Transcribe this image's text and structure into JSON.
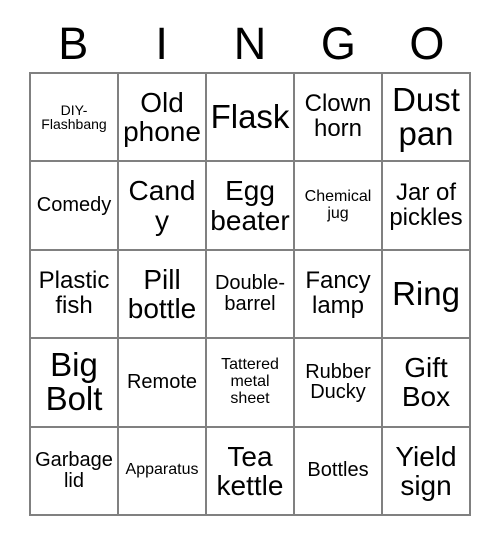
{
  "card": {
    "headers": [
      "B",
      "I",
      "N",
      "G",
      "O"
    ],
    "rows": [
      [
        {
          "text": "DIY-Flashbang",
          "size": "xxs"
        },
        {
          "text": "Old phone",
          "size": "lg"
        },
        {
          "text": "Flask",
          "size": "xl"
        },
        {
          "text": "Clown horn",
          "size": "md"
        },
        {
          "text": "Dust pan",
          "size": "xl"
        }
      ],
      [
        {
          "text": "Comedy",
          "size": "sm"
        },
        {
          "text": "Candy",
          "size": "lg"
        },
        {
          "text": "Egg beater",
          "size": "lg"
        },
        {
          "text": "Chemical jug",
          "size": "xs"
        },
        {
          "text": "Jar of pickles",
          "size": "md"
        }
      ],
      [
        {
          "text": "Plastic fish",
          "size": "md"
        },
        {
          "text": "Pill bottle",
          "size": "lg"
        },
        {
          "text": "Double-barrel",
          "size": "sm"
        },
        {
          "text": "Fancy lamp",
          "size": "md"
        },
        {
          "text": "Ring",
          "size": "xl"
        }
      ],
      [
        {
          "text": "Big Bolt",
          "size": "xl"
        },
        {
          "text": "Remote",
          "size": "sm"
        },
        {
          "text": "Tattered metal sheet",
          "size": "xs"
        },
        {
          "text": "Rubber Ducky",
          "size": "sm"
        },
        {
          "text": "Gift Box",
          "size": "lg"
        }
      ],
      [
        {
          "text": "Garbage lid",
          "size": "sm"
        },
        {
          "text": "Apparatus",
          "size": "xs"
        },
        {
          "text": "Tea kettle",
          "size": "lg"
        },
        {
          "text": "Bottles",
          "size": "sm"
        },
        {
          "text": "Yield sign",
          "size": "lg"
        }
      ]
    ]
  },
  "colors": {
    "border": "#808080",
    "text": "#000000",
    "background": "#ffffff"
  }
}
